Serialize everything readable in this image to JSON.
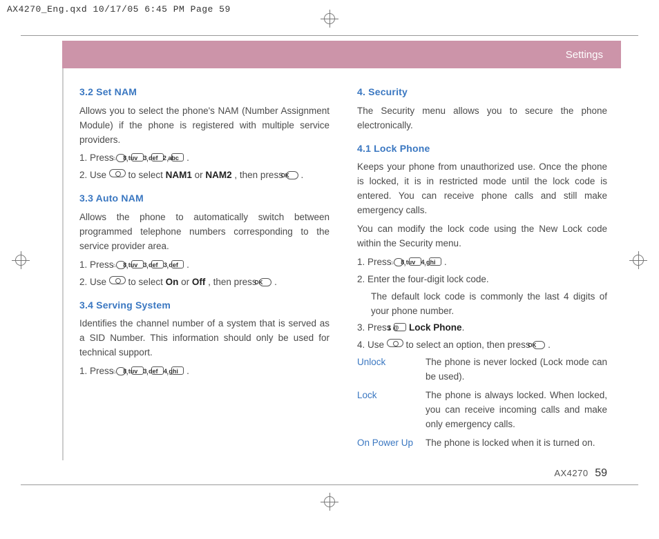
{
  "slug": "AX4270_Eng.qxd  10/17/05  6:45 PM  Page 59",
  "header": {
    "title": "Settings"
  },
  "footer": {
    "model": "AX4270",
    "page": "59"
  },
  "keys": {
    "menu": "⌂",
    "k8": "8 tuv",
    "k3": "3 def",
    "k2": "2 abc",
    "k4": "4 ghi",
    "k1": "1 @",
    "ok": "OK"
  },
  "left": {
    "h32": "3.2 Set NAM",
    "p32": "Allows you to select the phone's NAM (Number Assignment Module) if the phone is registered with multiple service providers.",
    "s32a_pre": "1.  Press ",
    "s32b_pre": "2.  Use ",
    "s32b_mid": " to select ",
    "s32b_b1": "NAM1",
    "s32b_or": " or ",
    "s32b_b2": "NAM2",
    "s32b_post": ", then press ",
    "h33": "3.3 Auto NAM",
    "p33": "Allows the phone to automatically switch between programmed telephone numbers corresponding to the service provider area.",
    "s33a_pre": "1.  Press ",
    "s33b_pre": "2.  Use ",
    "s33b_mid": " to select ",
    "s33b_b1": "On",
    "s33b_or": " or ",
    "s33b_b2": "Off",
    "s33b_post": ", then press ",
    "h34": "3.4 Serving System",
    "p34": "Identifies the channel number of a system that is served as a SID Number. This information should only be used for technical support.",
    "s34a_pre": "1.   Press "
  },
  "right": {
    "h4": "4. Security",
    "p4": "The Security menu allows you to secure the phone electronically.",
    "h41": "4.1 Lock Phone",
    "p41a": "Keeps your phone from unauthorized use. Once the phone is locked, it is in restricted mode until the lock code is entered. You can receive phone calls and still make emergency calls.",
    "p41b": "You can modify the lock code using the New Lock code within the Security menu.",
    "s41a_pre": "1.  Press ",
    "s41b": "2.  Enter the four-digit lock code.",
    "s41b_sub": "The default lock code is commonly the last 4 digits of your phone number.",
    "s41c_pre": "3.  Press ",
    "s41c_b": "Lock Phone",
    "s41d_pre": "4.  Use ",
    "s41d_mid": " to select an option, then press ",
    "opts": {
      "unlock_t": "Unlock",
      "unlock_d": "The phone is never locked (Lock mode can be used).",
      "lock_t": "Lock",
      "lock_d": "The phone is always locked. When locked, you can receive incoming calls and make only emergency calls.",
      "pu_t": "On Power Up",
      "pu_d": "The phone is locked when it is turned on."
    }
  }
}
